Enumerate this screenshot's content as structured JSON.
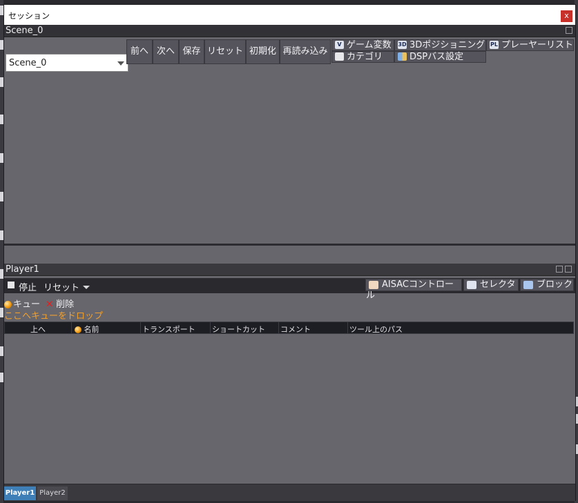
{
  "window": {
    "title": "セッション",
    "close_label": "x"
  },
  "scene_panel": {
    "title": "Scene_0",
    "scene_select": {
      "value": "Scene_0"
    },
    "toolbar": {
      "prev": "前へ",
      "next": "次へ",
      "save": "保存",
      "reset": "リセット",
      "initialize": "初期化",
      "reload": "再読み込み"
    },
    "chips": {
      "game_variables": "ゲーム変数",
      "positioning_3d": "3Dポジショニング",
      "player_list": "プレーヤーリスト",
      "category": "カテゴリ",
      "dsp_bus_settings": "DSPバス設定"
    },
    "chip_icon_text": {
      "game_variables": "V",
      "positioning_3d": "3D",
      "player_list": "PL"
    }
  },
  "player_panel": {
    "title": "Player1",
    "toolbar": {
      "stop": "停止",
      "reset": "リセット",
      "aisac": "AISACコントロール",
      "selector": "セレクタ",
      "block": "ブロック"
    },
    "cue_actions": {
      "cue": "キュー",
      "delete": "削除"
    },
    "drop_hint": "ここへキューをドロップ",
    "columns": [
      "上へ",
      "名前",
      "トランスポート",
      "ショートカット",
      "コメント",
      "ツール上のパス"
    ],
    "tabs": [
      "Player1",
      "Player2"
    ],
    "active_tab": "Player1"
  },
  "colors": {
    "panel_bg": "#67666c",
    "header_bg": "#323236",
    "button_bg": "#55535b",
    "close_red": "#c8302a",
    "drop_hint": "#f0a030",
    "active_tab": "#3f7fb8"
  }
}
